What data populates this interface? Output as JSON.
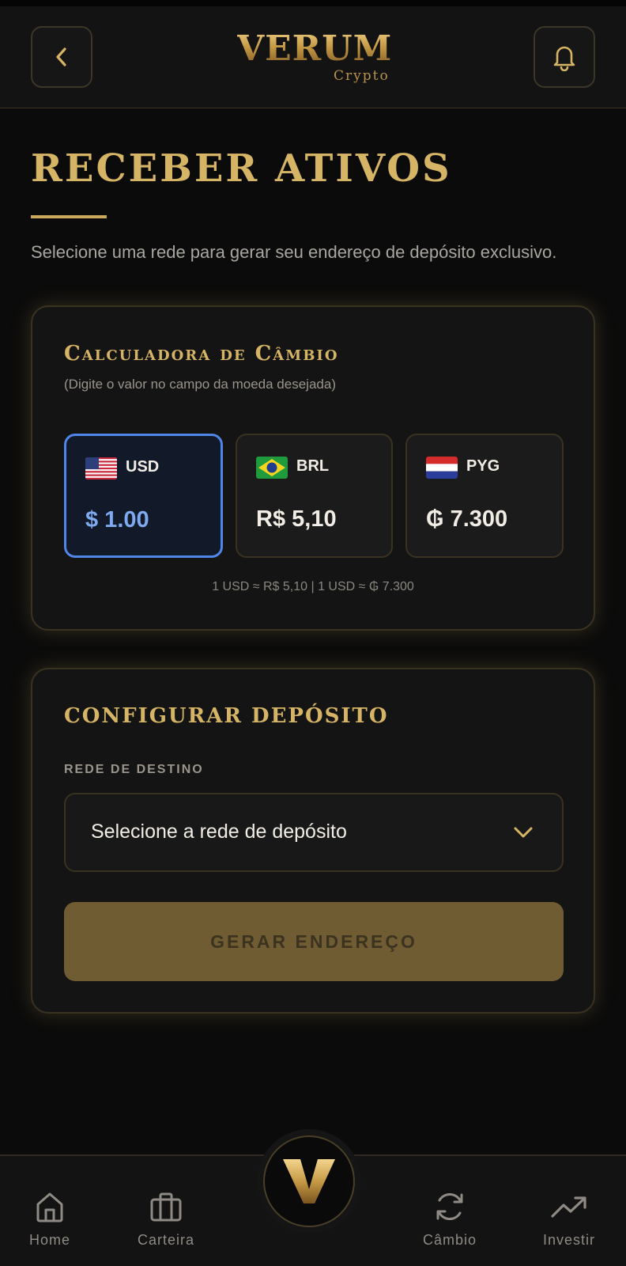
{
  "header": {
    "logo_word": "VERUM",
    "logo_sub": "Crypto",
    "back_icon": "chevron-left-icon",
    "bell_icon": "bell-icon"
  },
  "page": {
    "title": "RECEBER ATIVOS",
    "description": "Selecione uma rede para gerar seu endereço de depósito exclusivo."
  },
  "calculator": {
    "title": "Calculadora de Câmbio",
    "subtitle": "(Digite o valor no campo da moeda desejada)",
    "currencies": [
      {
        "code": "USD",
        "value": "$ 1.00",
        "flag": "us-flag",
        "selected": true
      },
      {
        "code": "BRL",
        "value": "R$ 5,10",
        "flag": "br-flag",
        "selected": false
      },
      {
        "code": "PYG",
        "value": "₲ 7.300",
        "flag": "py-flag",
        "selected": false
      }
    ],
    "rates": "1 USD ≈ R$ 5,10 | 1 USD ≈ ₲ 7.300"
  },
  "deposit": {
    "title": "CONFIGURAR DEPÓSITO",
    "network_label": "REDE DE DESTINO",
    "network_placeholder": "Selecione a rede de depósito",
    "generate_label": "GERAR ENDEREÇO"
  },
  "nav": {
    "items": [
      {
        "label": "Home",
        "icon": "home-icon"
      },
      {
        "label": "Carteira",
        "icon": "briefcase-icon"
      },
      {
        "label": "Câmbio",
        "icon": "exchange-icon"
      },
      {
        "label": "Investir",
        "icon": "trending-up-icon"
      }
    ],
    "center_icon": "verum-v-logo-icon"
  },
  "colors": {
    "gold": "#d6b465",
    "accent_blue": "#4f86e8",
    "background": "#0b0b0b",
    "card": "#141414",
    "button_disabled": "#6f5c32"
  }
}
